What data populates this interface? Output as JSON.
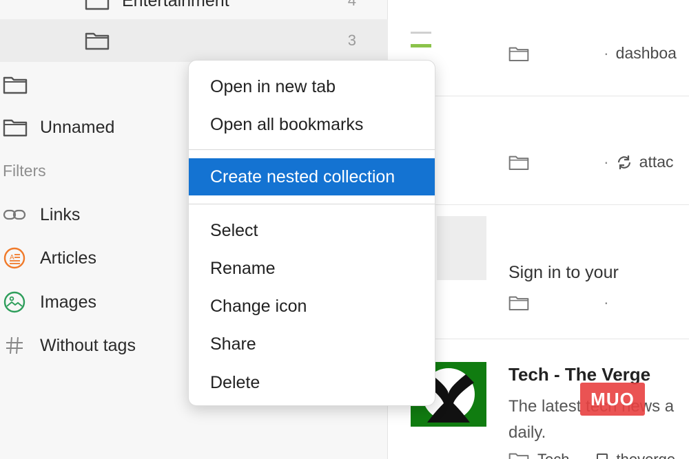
{
  "sidebar": {
    "rows": [
      {
        "label": "Entertainment",
        "count": "4"
      },
      {
        "label": "",
        "count": "3"
      },
      {
        "label": "",
        "count": ""
      },
      {
        "label": "Unnamed",
        "count": ""
      }
    ],
    "filters_title": "Filters",
    "filters": [
      {
        "label": "Links",
        "icon": "link-icon"
      },
      {
        "label": "Articles",
        "icon": "article-icon"
      },
      {
        "label": "Images",
        "icon": "image-icon"
      },
      {
        "label": "Without tags",
        "icon": "hash-icon"
      }
    ]
  },
  "main": {
    "items": [
      {
        "meta_text": "dashboa"
      },
      {
        "meta_text": "attac"
      },
      {
        "title": "Sign in to your",
        "meta_text": ""
      },
      {
        "title": "Tech - The Verge",
        "description": "The latest tech news a daily.",
        "meta_text": "Tech",
        "domain": "theverge"
      }
    ]
  },
  "context_menu": {
    "items": [
      "Open in new tab",
      "Open all bookmarks",
      "Create nested collection",
      "Select",
      "Rename",
      "Change icon",
      "Share",
      "Delete"
    ],
    "active_index": 2
  },
  "watermark": "MUO",
  "colors": {
    "menu_highlight": "#1473d2",
    "accent_green": "#8bc34a",
    "xbox_green": "#107c10",
    "articles_orange": "#f07a2a",
    "images_green": "#2e9e5b"
  }
}
